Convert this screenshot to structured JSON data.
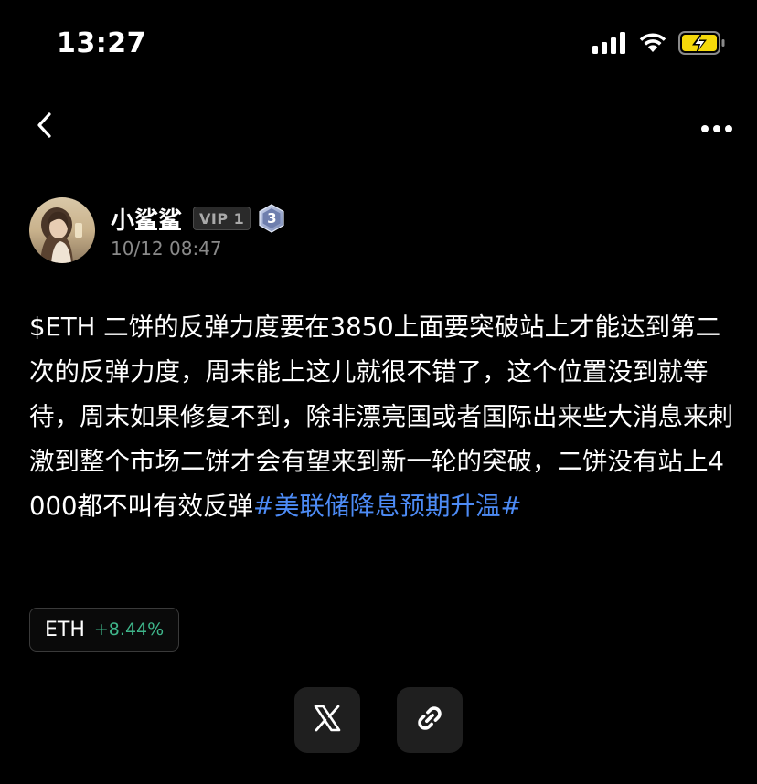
{
  "status_bar": {
    "time": "13:27"
  },
  "nav": {
    "back_icon": "chevron-left-icon",
    "more_icon": "more-horizontal-icon"
  },
  "author": {
    "name": "小鲨鲨",
    "vip_label": "VIP 1",
    "level": "3",
    "posted_at": "10/12 08:47"
  },
  "post": {
    "text": "$ETH 二饼的反弹力度要在3850上面要突破站上才能达到第二次的反弹力度，周末能上这儿就很不错了，这个位置没到就等待，周末如果修复不到，除非漂亮国或者国际出来些大消息来刺激到整个市场二饼才会有望来到新一轮的突破，二饼没有站上4000都不叫有效反弹",
    "hashtag": "#美联储降息预期升温#"
  },
  "coin_chip": {
    "symbol": "ETH",
    "change": "+8.44%"
  },
  "share": {
    "x_icon": "x-logo-icon",
    "link_icon": "link-icon"
  },
  "colors": {
    "background": "#000000",
    "hashtag": "#4d8bf5",
    "positive": "#3fb68b",
    "muted": "#8a8a8a",
    "battery_fill": "#f5d90a"
  }
}
